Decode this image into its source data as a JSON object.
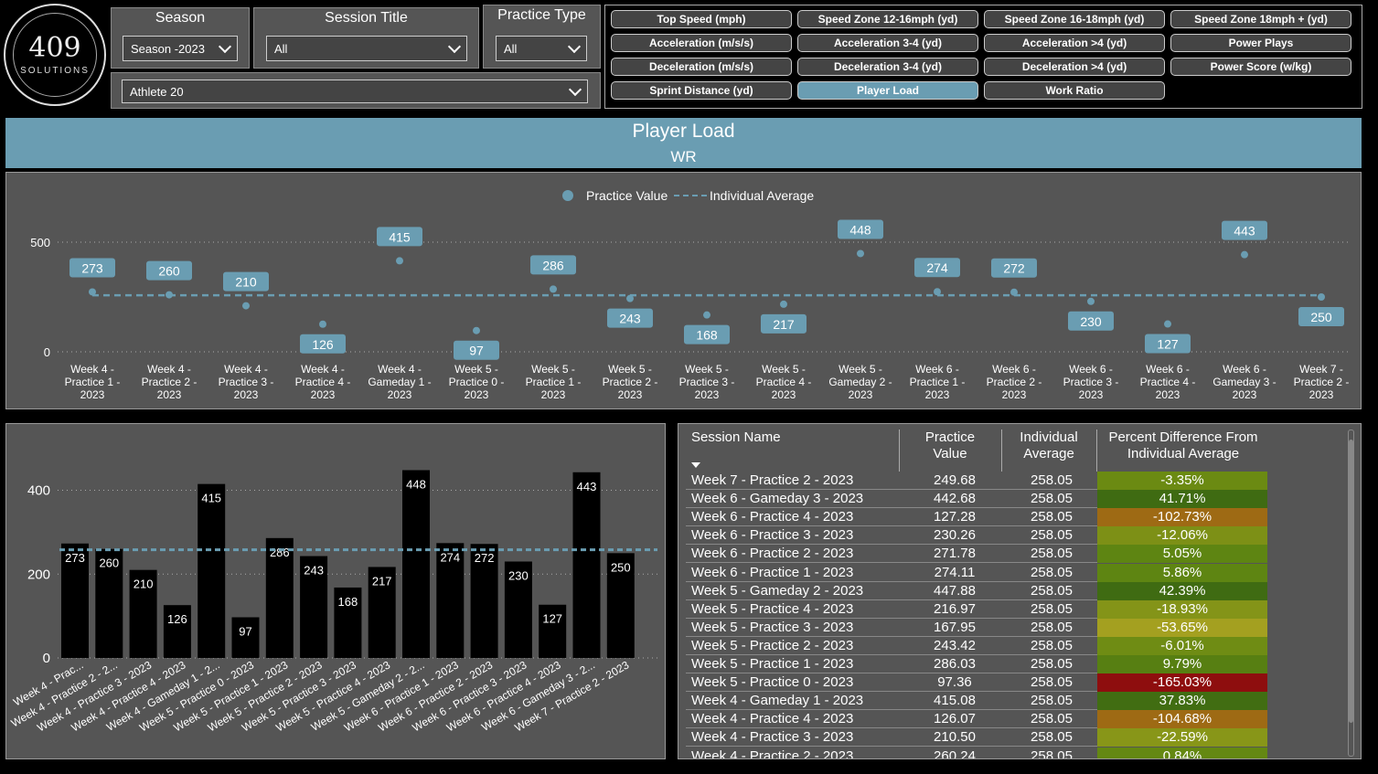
{
  "logo": {
    "number": "409",
    "subtitle": "SOLUTIONS"
  },
  "filters": {
    "season": {
      "title": "Season",
      "value": "Season -2023"
    },
    "session_title": {
      "title": "Session Title",
      "value": "All"
    },
    "practice_type": {
      "title": "Practice Type",
      "value": "All"
    },
    "athlete": {
      "value": "Athlete 20"
    }
  },
  "metric_buttons": [
    {
      "label": "Top Speed (mph)",
      "active": false
    },
    {
      "label": "Speed Zone 12-16mph (yd)",
      "active": false
    },
    {
      "label": "Speed Zone 16-18mph (yd)",
      "active": false
    },
    {
      "label": "Speed Zone 18mph + (yd)",
      "active": false
    },
    {
      "label": "Acceleration (m/s/s)",
      "active": false
    },
    {
      "label": "Acceleration 3-4 (yd)",
      "active": false
    },
    {
      "label": "Acceleration >4 (yd)",
      "active": false
    },
    {
      "label": "Power Plays",
      "active": false
    },
    {
      "label": "Deceleration (m/s/s)",
      "active": false
    },
    {
      "label": "Deceleration 3-4 (yd)",
      "active": false
    },
    {
      "label": "Deceleration >4 (yd)",
      "active": false
    },
    {
      "label": "Power Score (w/kg)",
      "active": false
    },
    {
      "label": "Sprint Distance (yd)",
      "active": false
    },
    {
      "label": "Player Load",
      "active": true
    },
    {
      "label": "Work Ratio",
      "active": false
    }
  ],
  "header": {
    "title": "Player Load",
    "subtitle": "WR"
  },
  "chart_data": [
    {
      "type": "line",
      "legend": [
        "Practice Value",
        "Individual Average"
      ],
      "legend_position": "top-center",
      "categories": [
        "Week 4 - Practice 1 - 2023",
        "Week 4 - Practice 2 - 2023",
        "Week 4 - Practice 3 - 2023",
        "Week 4 - Practice 4 - 2023",
        "Week 4 - Gameday 1 - 2023",
        "Week 5 - Practice 0 - 2023",
        "Week 5 - Practice 1 - 2023",
        "Week 5 - Practice 2 - 2023",
        "Week 5 - Practice 3 - 2023",
        "Week 5 - Practice 4 - 2023",
        "Week 5 - Gameday 2 - 2023",
        "Week 6 - Practice 1 - 2023",
        "Week 6 - Practice 2 - 2023",
        "Week 6 - Practice 3 - 2023",
        "Week 6 - Practice 4 - 2023",
        "Week 6 - Gameday 3 - 2023",
        "Week 7 - Practice 2 - 2023"
      ],
      "series": [
        {
          "name": "Practice Value",
          "values": [
            273,
            260,
            210,
            126,
            415,
            97,
            286,
            243,
            168,
            217,
            448,
            274,
            272,
            230,
            127,
            443,
            250
          ]
        },
        {
          "name": "Individual Average",
          "values": [
            258.05,
            258.05,
            258.05,
            258.05,
            258.05,
            258.05,
            258.05,
            258.05,
            258.05,
            258.05,
            258.05,
            258.05,
            258.05,
            258.05,
            258.05,
            258.05,
            258.05
          ]
        }
      ],
      "yticks": [
        0,
        500
      ],
      "ylim": [
        0,
        500
      ],
      "grid": true
    },
    {
      "type": "bar",
      "categories": [
        "Week 4 - Prac...",
        "Week 4 - Practice 2 - 2...",
        "Week 4 - Practice 3 - 2023",
        "Week 4 - Practice 4 - 2023",
        "Week 4 - Gameday 1 - 2...",
        "Week 5 - Practice 0 - 2023",
        "Week 5 - Practice 1 - 2023",
        "Week 5 - Practice 2 - 2023",
        "Week 5 - Practice 3 - 2023",
        "Week 5 - Practice 4 - 2023",
        "Week 5 - Gameday 2 - 2...",
        "Week 6 - Practice 1 - 2023",
        "Week 6 - Practice 2 - 2023",
        "Week 6 - Practice 3 - 2023",
        "Week 6 - Practice 4 - 2023",
        "Week 6 - Gameday 3 - 2...",
        "Week 7 - Practice 2 - 2023"
      ],
      "values": [
        273,
        260,
        210,
        126,
        415,
        97,
        286,
        243,
        168,
        217,
        448,
        274,
        272,
        230,
        127,
        443,
        250
      ],
      "average": 258.05,
      "yticks": [
        0,
        200,
        400
      ],
      "ylim": [
        0,
        460
      ],
      "grid": true
    }
  ],
  "table": {
    "headers": [
      "Session Name",
      "Practice Value",
      "Individual Average",
      "Percent Difference From Individual Average"
    ],
    "rows": [
      {
        "name": "Week 7 - Practice 2 - 2023",
        "value": "249.68",
        "avg": "258.05",
        "pct": "-3.35%",
        "color": "#6b8a12"
      },
      {
        "name": "Week 6 - Gameday 3 - 2023",
        "value": "442.68",
        "avg": "258.05",
        "pct": "41.71%",
        "color": "#3f6b12"
      },
      {
        "name": "Week 6 - Practice 4 - 2023",
        "value": "127.28",
        "avg": "258.05",
        "pct": "-102.73%",
        "color": "#9e6a14"
      },
      {
        "name": "Week 6 - Practice 3 - 2023",
        "value": "230.26",
        "avg": "258.05",
        "pct": "-12.06%",
        "color": "#7d9016"
      },
      {
        "name": "Week 6 - Practice 2 - 2023",
        "value": "271.78",
        "avg": "258.05",
        "pct": "5.05%",
        "color": "#5e8512"
      },
      {
        "name": "Week 6 - Practice 1 - 2023",
        "value": "274.11",
        "avg": "258.05",
        "pct": "5.86%",
        "color": "#5e8512"
      },
      {
        "name": "Week 5 - Gameday 2 - 2023",
        "value": "447.88",
        "avg": "258.05",
        "pct": "42.39%",
        "color": "#3f6b12"
      },
      {
        "name": "Week 5 - Practice 4 - 2023",
        "value": "216.97",
        "avg": "258.05",
        "pct": "-18.93%",
        "color": "#849418"
      },
      {
        "name": "Week 5 - Practice 3 - 2023",
        "value": "167.95",
        "avg": "258.05",
        "pct": "-53.65%",
        "color": "#a4a020"
      },
      {
        "name": "Week 5 - Practice 2 - 2023",
        "value": "243.42",
        "avg": "258.05",
        "pct": "-6.01%",
        "color": "#6f8c14"
      },
      {
        "name": "Week 5 - Practice 1 - 2023",
        "value": "286.03",
        "avg": "258.05",
        "pct": "9.79%",
        "color": "#577f12"
      },
      {
        "name": "Week 5 - Practice 0 - 2023",
        "value": "97.36",
        "avg": "258.05",
        "pct": "-165.03%",
        "color": "#8e0e0e"
      },
      {
        "name": "Week 4 - Gameday 1 - 2023",
        "value": "415.08",
        "avg": "258.05",
        "pct": "37.83%",
        "color": "#416d12"
      },
      {
        "name": "Week 4 - Practice 4 - 2023",
        "value": "126.07",
        "avg": "258.05",
        "pct": "-104.68%",
        "color": "#9e6a14"
      },
      {
        "name": "Week 4 - Practice 3 - 2023",
        "value": "210.50",
        "avg": "258.05",
        "pct": "-22.59%",
        "color": "#889618"
      },
      {
        "name": "Week 4 - Practice 2 - 2023",
        "value": "260.24",
        "avg": "258.05",
        "pct": "0.84%",
        "color": "#648812"
      }
    ]
  },
  "colors": {
    "accent": "#6a9db2",
    "panel": "#555555",
    "bar": "#000000"
  }
}
